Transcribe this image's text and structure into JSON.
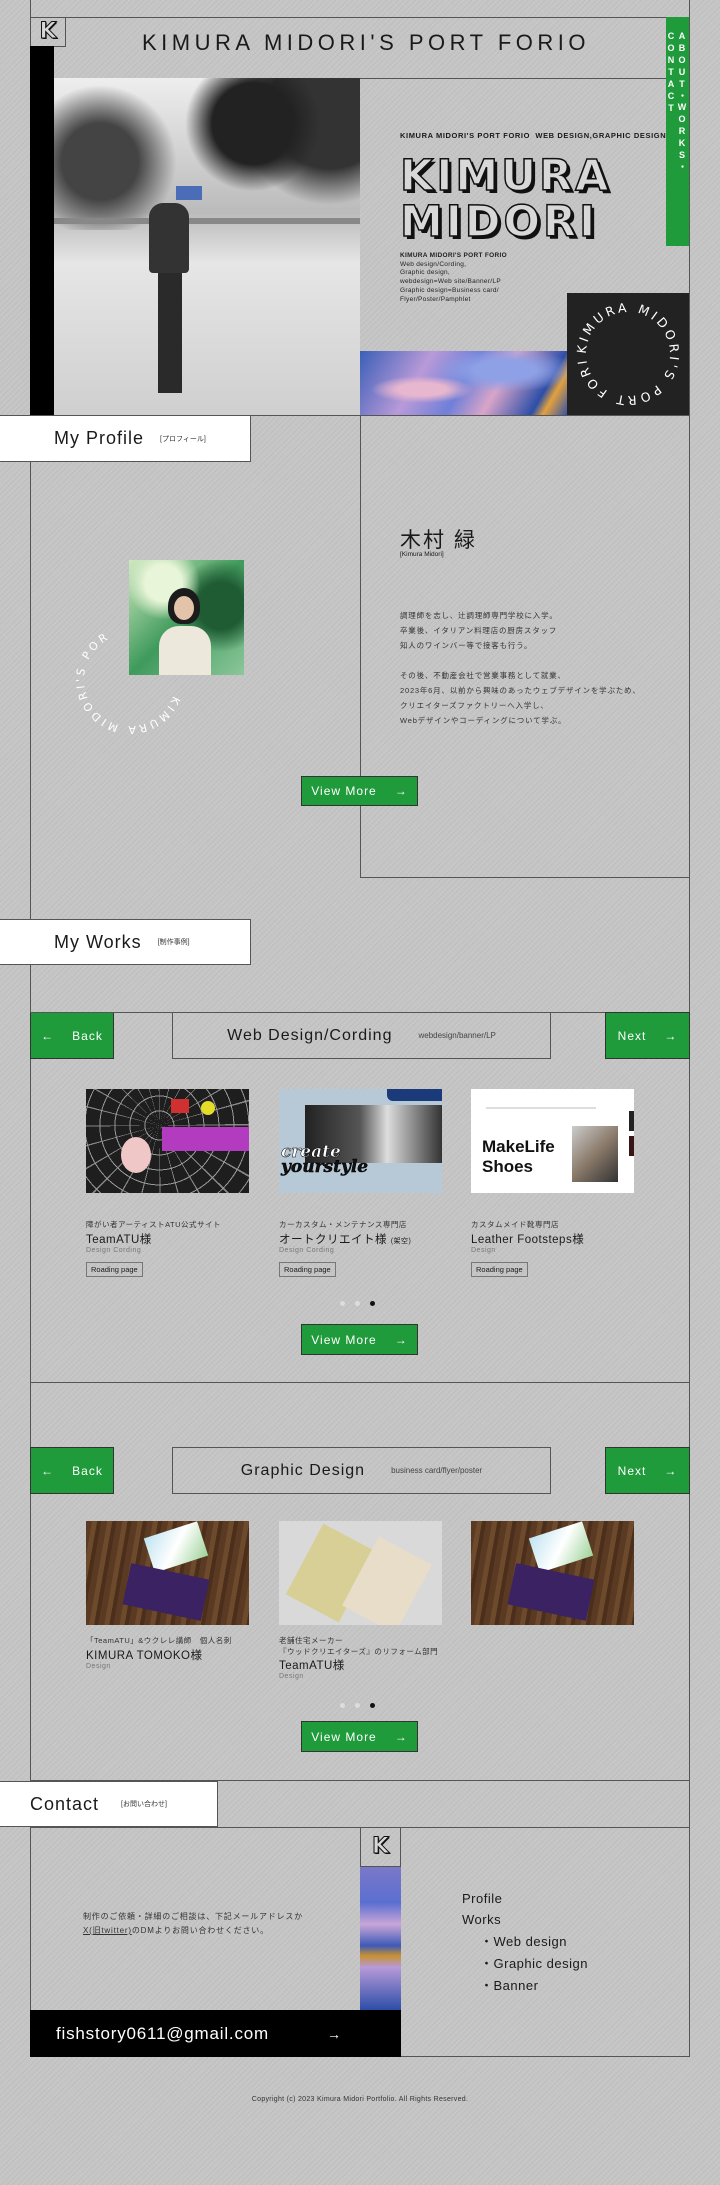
{
  "header": {
    "title": "KIMURA MIDORI'S PORT FORIO",
    "logo_letter": "K"
  },
  "side_nav": {
    "label": "ABOUT・WORKS・CONTACT"
  },
  "hero": {
    "caption": "KIMURA MIDORI'S PORT FORIO  WEB DESIGN,GRAPHIC DESIGN",
    "name_line1": "KIMURA",
    "name_line2": "MIDORI",
    "details": [
      "KIMURA MIDORI'S PORT FORIO",
      "Web design/Cording,",
      "Graphic design,",
      "webdesign=Web site/Banner/LP",
      "Graphic design=Business card/",
      "Flyer/Poster/Pamphlet"
    ],
    "circle_text": "KIMURA MIDORI'S PORT FORIO "
  },
  "profile": {
    "heading": "My Profile",
    "heading_sub": "[プロフィール]",
    "name": "木村 緑",
    "name_roman": "[Kimura Midori]",
    "bio1": [
      "調理師を志し、辻調理師専門学校に入学。",
      "卒業後、イタリアン料理店の厨房スタッフ",
      "知人のワインバー等で接客も行う。"
    ],
    "bio2": [
      "その後、不動産会社で営業事務として就業、",
      "2023年6月、以前から興味のあったウェブデザインを学ぶため、",
      "クリエイターズファクトリーへ入学し、",
      "Webデザインやコーディングについて学ぶ。"
    ],
    "circle_text": "KIMURA MIDORI'S POR",
    "view_more": "View More"
  },
  "works": {
    "heading": "My Works",
    "heading_sub": "[制作事例]",
    "back": "Back",
    "next": "Next",
    "web": {
      "title": "Web Design/Cording",
      "subtitle": "webdesign/banner/LP",
      "cards": [
        {
          "category": "障がい者アーティストATU公式サイト",
          "title": "TeamATU様",
          "tags": "Design  Cording",
          "button": "Roading page"
        },
        {
          "category": "カーカスタム・メンテナンス専門店",
          "title": "オートクリエイト様",
          "note": "(架空)",
          "tags": "Design  Cording",
          "button": "Roading page",
          "image_text": [
            "create",
            "yourstyle"
          ]
        },
        {
          "category": "カスタムメイド靴専門店",
          "title": "Leather Footsteps様",
          "tags": "Design",
          "button": "Roading page",
          "image_text": [
            "MakeLife",
            "Shoes"
          ]
        }
      ],
      "active_dot": 3,
      "view_more": "View More"
    },
    "graphic": {
      "title": "Graphic Design",
      "subtitle": "business card/flyer/poster",
      "cards": [
        {
          "category": [
            "「TeamATU」&ウクレレ講師　個人名刺"
          ],
          "title": "KIMURA TOMOKO様",
          "tags": "Design"
        },
        {
          "category": [
            "老舗住宅メーカー",
            "『ウッドクリエイターズ』のリフォーム部門"
          ],
          "title": "TeamATU様",
          "tags": "Design"
        },
        {
          "category": [],
          "title": "",
          "tags": ""
        }
      ],
      "active_dot": 3,
      "view_more": "View More"
    }
  },
  "contact": {
    "heading": "Contact",
    "heading_sub": "[お問い合わせ]",
    "text1": "制作のご依頼・詳細のご相談は、下記メールアドレスか",
    "text2_link": "X(旧twitter)",
    "text2_rest": "のDMよりお問い合わせください。",
    "email": "fishstory0611@gmail.com",
    "nav": {
      "profile": "Profile",
      "works": "Works",
      "items": [
        "Web design",
        "Graphic design",
        "Banner"
      ]
    }
  },
  "footer": {
    "copyright": "Copyright (c) 2023 Kimura Midori Portfolio. All Rights Reserved."
  },
  "colors": {
    "accent": "#1f9b3b",
    "background": "#c5c5c5",
    "dark": "#222222"
  }
}
